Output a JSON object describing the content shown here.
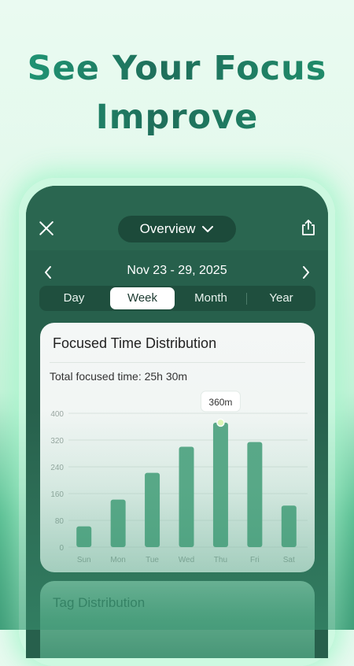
{
  "headline": {
    "line1": "See Your Focus",
    "line2": "Improve"
  },
  "topbar": {
    "title": "Overview"
  },
  "date_nav": {
    "range": "Nov 23 - 29, 2025"
  },
  "period_tabs": [
    {
      "label": "Day",
      "active": false
    },
    {
      "label": "Week",
      "active": true
    },
    {
      "label": "Month",
      "active": false
    },
    {
      "label": "Year",
      "active": false
    }
  ],
  "card": {
    "title": "Focused Time Distribution",
    "total": "Total focused time: 25h 30m",
    "tooltip": "360m"
  },
  "chart_data": {
    "type": "bar",
    "categories": [
      "Sun",
      "Mon",
      "Tue",
      "Wed",
      "Thu",
      "Fri",
      "Sat"
    ],
    "values": [
      62,
      142,
      222,
      300,
      372,
      314,
      124
    ],
    "ylim": [
      0,
      400
    ],
    "yticks": [
      "0",
      "80",
      "160",
      "240",
      "320",
      "400"
    ],
    "highlight_index": 4,
    "grid": true,
    "bar_color": "#5aa888"
  },
  "tag_card": {
    "title": "Tag Distribution"
  },
  "colors": {
    "accent": "#1f7a5f",
    "phone_bg": "#27604c"
  }
}
